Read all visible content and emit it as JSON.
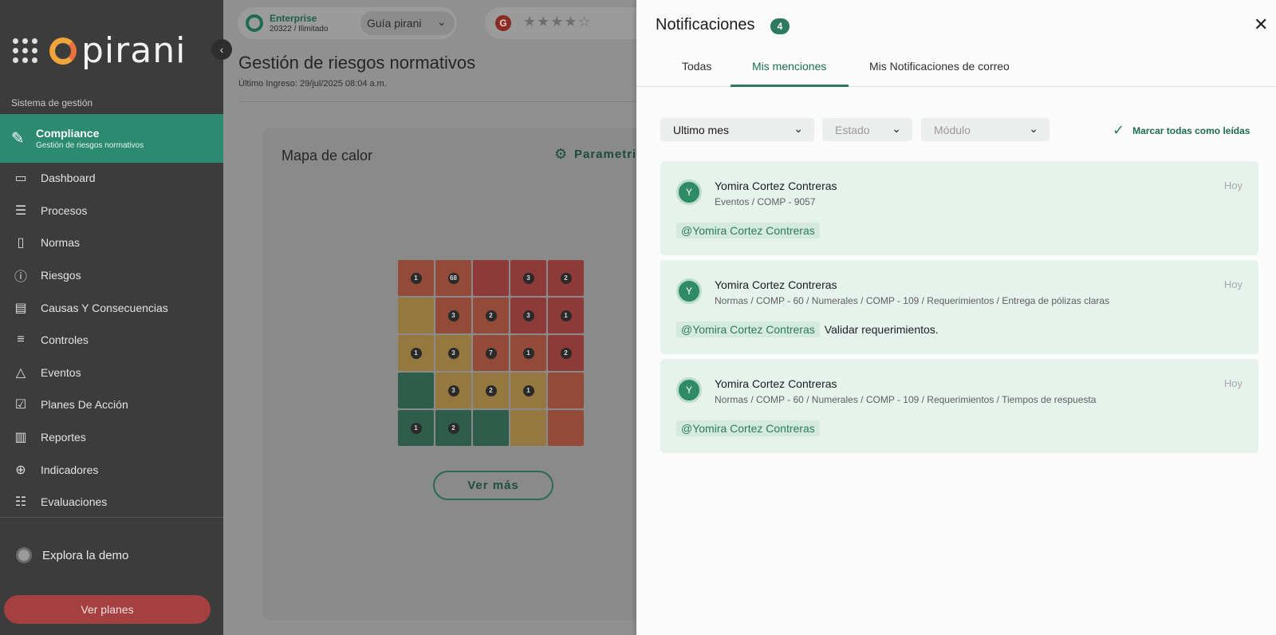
{
  "sidebar": {
    "logo_text": "pirani",
    "section_label": "Sistema de gestión",
    "active": {
      "title": "Compliance",
      "subtitle": "Gestión de riesgos normativos"
    },
    "items": [
      {
        "label": "Dashboard",
        "icon": "monitor-icon"
      },
      {
        "label": "Procesos",
        "icon": "list-icon"
      },
      {
        "label": "Normas",
        "icon": "document-icon"
      },
      {
        "label": "Riesgos",
        "icon": "alert-circle-icon"
      },
      {
        "label": "Causas Y Consecuencias",
        "icon": "layout-icon"
      },
      {
        "label": "Controles",
        "icon": "sliders-icon"
      },
      {
        "label": "Eventos",
        "icon": "warning-triangle-icon"
      },
      {
        "label": "Planes De Acción",
        "icon": "clipboard-check-icon"
      },
      {
        "label": "Reportes",
        "icon": "bar-chart-icon"
      },
      {
        "label": "Indicadores",
        "icon": "crosshair-icon"
      },
      {
        "label": "Evaluaciones",
        "icon": "checklist-icon"
      }
    ],
    "demo_label": "Explora la demo",
    "plans_button": "Ver planes"
  },
  "main": {
    "plan": {
      "title": "Enterprise",
      "subtitle": "20322 / Ilimitado"
    },
    "guide": "Guía pirani",
    "rating_stars": "★★★★☆",
    "page_title": "Gestión de riesgos normativos",
    "last_login": "Último Ingreso: 29/jul/2025 08:04 a.m.",
    "card_title": "Mapa de calor",
    "parametrize": "Parametriz",
    "see_more": "Ver más",
    "heatmap": [
      [
        {
          "v": "1",
          "c": "ored"
        },
        {
          "v": "68",
          "c": "ored"
        },
        {
          "v": "",
          "c": "red"
        },
        {
          "v": "3",
          "c": "red"
        },
        {
          "v": "2",
          "c": "red"
        }
      ],
      [
        {
          "v": "",
          "c": "yellow"
        },
        {
          "v": "3",
          "c": "ored"
        },
        {
          "v": "2",
          "c": "ored"
        },
        {
          "v": "3",
          "c": "red"
        },
        {
          "v": "1",
          "c": "red"
        }
      ],
      [
        {
          "v": "1",
          "c": "yellow"
        },
        {
          "v": "3",
          "c": "yellow"
        },
        {
          "v": "7",
          "c": "ored"
        },
        {
          "v": "1",
          "c": "ored"
        },
        {
          "v": "2",
          "c": "red"
        }
      ],
      [
        {
          "v": "",
          "c": "green"
        },
        {
          "v": "3",
          "c": "yellow"
        },
        {
          "v": "2",
          "c": "yellow"
        },
        {
          "v": "1",
          "c": "yellow"
        },
        {
          "v": "",
          "c": "ored"
        }
      ],
      [
        {
          "v": "1",
          "c": "green"
        },
        {
          "v": "2",
          "c": "green"
        },
        {
          "v": "",
          "c": "green"
        },
        {
          "v": "",
          "c": "yellow"
        },
        {
          "v": "",
          "c": "ored"
        }
      ]
    ]
  },
  "panel": {
    "title": "Notificaciones",
    "count": "4",
    "tabs": [
      "Todas",
      "Mis menciones",
      "Mis Notificaciones de correo"
    ],
    "active_tab": "Mis menciones",
    "filters": {
      "period": "Ultimo mes",
      "status_placeholder": "Estado",
      "module_placeholder": "Módulo"
    },
    "mark_all": "Marcar todas como leídas",
    "notifications": [
      {
        "initial": "Y",
        "name": "Yomira Cortez Contreras",
        "path": "Eventos / COMP - 9057",
        "time": "Hoy",
        "mention": "@Yomira Cortez Contreras",
        "message": ""
      },
      {
        "initial": "Y",
        "name": "Yomira Cortez Contreras",
        "path": "Normas / COMP - 60 / Numerales / COMP - 109 / Requerimientos / Entrega de pólizas claras",
        "time": "Hoy",
        "mention": "@Yomira Cortez Contreras",
        "message": "Validar requerimientos."
      },
      {
        "initial": "Y",
        "name": "Yomira Cortez Contreras",
        "path": "Normas / COMP - 60 / Numerales / COMP - 109 / Requerimientos / Tiempos de respuesta",
        "time": "Hoy",
        "mention": "@Yomira Cortez Contreras",
        "message": ""
      }
    ]
  },
  "colors": {
    "accent": "#2d7a5f",
    "sidebar_bg": "#3c3c3c",
    "danger": "#a44040"
  }
}
